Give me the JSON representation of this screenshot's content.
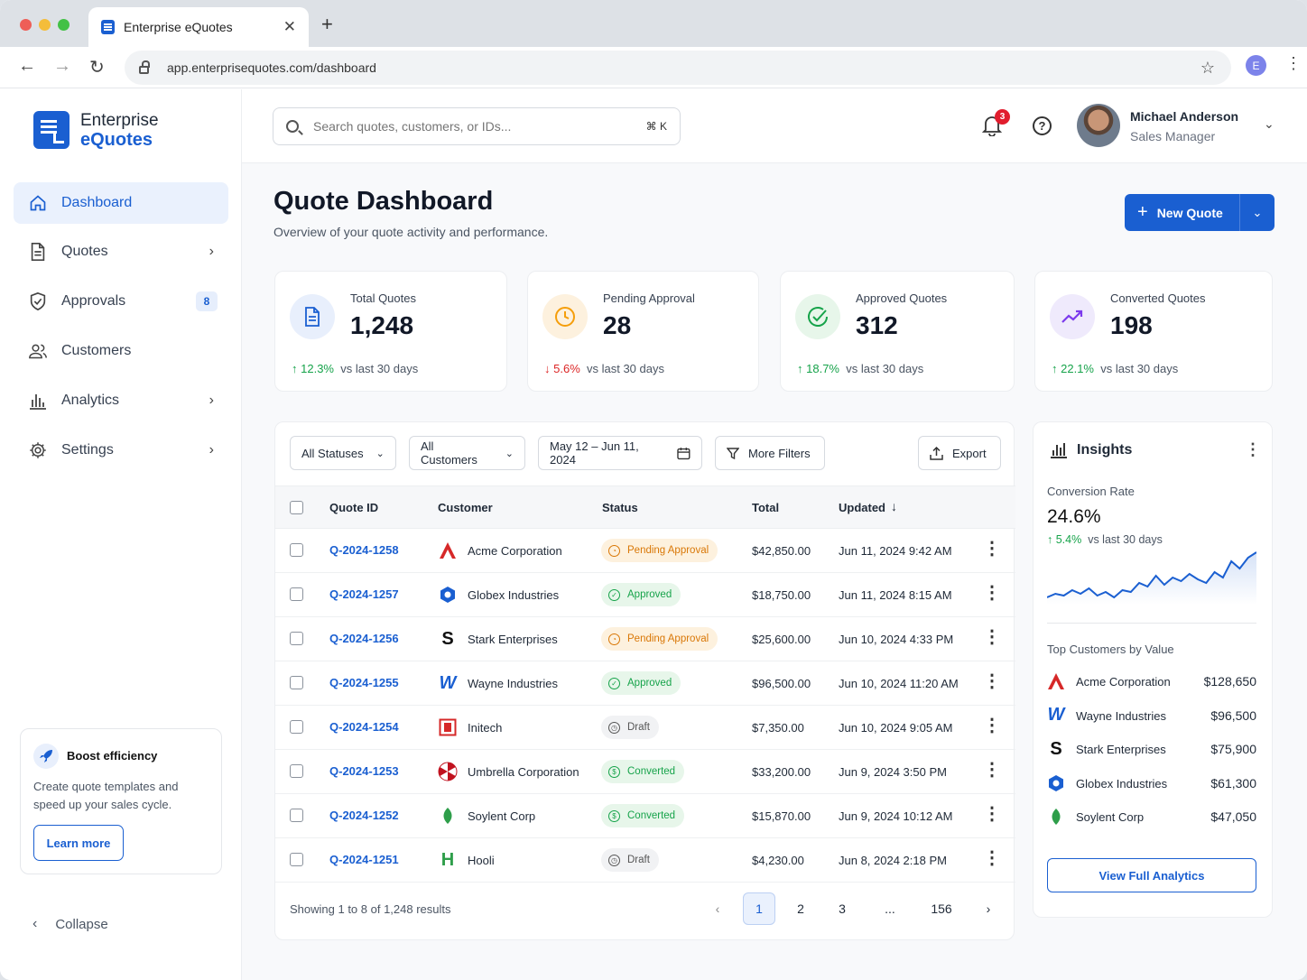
{
  "browser": {
    "tab_title": "Enterprise eQuotes",
    "url": "app.enterprisequotes.com/dashboard",
    "profile_initial": "E"
  },
  "sidebar": {
    "brand_line1": "Enterprise",
    "brand_line2": "eQuotes",
    "items": [
      {
        "label": "Dashboard",
        "icon": "home-icon"
      },
      {
        "label": "Quotes",
        "icon": "document-icon"
      },
      {
        "label": "Approvals",
        "icon": "shield-icon",
        "badge": "8"
      },
      {
        "label": "Customers",
        "icon": "users-icon"
      },
      {
        "label": "Analytics",
        "icon": "bar-chart-icon"
      },
      {
        "label": "Settings",
        "icon": "gear-icon"
      }
    ],
    "boost": {
      "title": "Boost efficiency",
      "desc": "Create quote templates and speed up your sales cycle.",
      "button": "Learn more"
    },
    "collapse": "Collapse"
  },
  "header": {
    "search_placeholder": "Search quotes, customers, or IDs...",
    "search_shortcut": "⌘ K",
    "notifications": "3",
    "user_name": "Michael Anderson",
    "user_role": "Sales Manager"
  },
  "page": {
    "title": "Quote Dashboard",
    "subtitle": "Overview of your quote activity and performance.",
    "new_quote": "New Quote"
  },
  "colors": {
    "brand": "#1a5fd1",
    "up": "#16a34a",
    "down": "#dc2626",
    "pending": "#d97706"
  },
  "stats": [
    {
      "label": "Total Quotes",
      "value": "1,248",
      "delta": "12.3%",
      "dir": "up",
      "suffix": "vs last 30 days",
      "icon": "document-icon"
    },
    {
      "label": "Pending Approval",
      "value": "28",
      "delta": "5.6%",
      "dir": "down",
      "suffix": "vs last 30 days",
      "icon": "clock-icon"
    },
    {
      "label": "Approved Quotes",
      "value": "312",
      "delta": "18.7%",
      "dir": "up",
      "suffix": "vs last 30 days",
      "icon": "check-circle-icon"
    },
    {
      "label": "Converted Quotes",
      "value": "198",
      "delta": "22.1%",
      "dir": "up",
      "suffix": "vs last 30 days",
      "icon": "trend-up-icon"
    }
  ],
  "filters": {
    "status": "All Statuses",
    "customers": "All Customers",
    "date_range": "May 12 – Jun 11, 2024",
    "more": "More Filters",
    "export": "Export"
  },
  "table": {
    "headers": [
      "Quote ID",
      "Customer",
      "Status",
      "Total",
      "Updated"
    ],
    "rows": [
      {
        "id": "Q-2024-1258",
        "customer": "Acme Corporation",
        "status": "Pending Approval",
        "status_kind": "pending",
        "total": "$42,850.00",
        "updated": "Jun 11, 2024 9:42 AM"
      },
      {
        "id": "Q-2024-1257",
        "customer": "Globex Industries",
        "status": "Approved",
        "status_kind": "approved",
        "total": "$18,750.00",
        "updated": "Jun 11, 2024 8:15 AM"
      },
      {
        "id": "Q-2024-1256",
        "customer": "Stark Enterprises",
        "status": "Pending Approval",
        "status_kind": "pending",
        "total": "$25,600.00",
        "updated": "Jun 10, 2024 4:33 PM"
      },
      {
        "id": "Q-2024-1255",
        "customer": "Wayne Industries",
        "status": "Approved",
        "status_kind": "approved",
        "total": "$96,500.00",
        "updated": "Jun 10, 2024 11:20 AM"
      },
      {
        "id": "Q-2024-1254",
        "customer": "Initech",
        "status": "Draft",
        "status_kind": "draft",
        "total": "$7,350.00",
        "updated": "Jun 10, 2024 9:05 AM"
      },
      {
        "id": "Q-2024-1253",
        "customer": "Umbrella Corporation",
        "status": "Converted",
        "status_kind": "converted",
        "total": "$33,200.00",
        "updated": "Jun 9, 2024 3:50 PM"
      },
      {
        "id": "Q-2024-1252",
        "customer": "Soylent Corp",
        "status": "Converted",
        "status_kind": "converted",
        "total": "$15,870.00",
        "updated": "Jun 9, 2024 10:12 AM"
      },
      {
        "id": "Q-2024-1251",
        "customer": "Hooli",
        "status": "Draft",
        "status_kind": "draft",
        "total": "$4,230.00",
        "updated": "Jun 8, 2024 2:18 PM"
      }
    ],
    "showing": "Showing 1 to 8 of 1,248 results",
    "pages": [
      "1",
      "2",
      "3",
      "...",
      "156"
    ]
  },
  "insights": {
    "title": "Insights",
    "conversion_label": "Conversion Rate",
    "conversion_value": "24.6%",
    "conversion_delta": "5.4%",
    "conversion_suffix": "vs last 30 days",
    "top_label": "Top Customers by Value",
    "top_customers": [
      {
        "name": "Acme Corporation",
        "value": "$128,650"
      },
      {
        "name": "Wayne Industries",
        "value": "$96,500"
      },
      {
        "name": "Stark Enterprises",
        "value": "$75,900"
      },
      {
        "name": "Globex Industries",
        "value": "$61,300"
      },
      {
        "name": "Soylent Corp",
        "value": "$47,050"
      }
    ],
    "button": "View Full Analytics"
  },
  "chart_data": {
    "type": "line",
    "series": [
      {
        "values": [
          18,
          20,
          19,
          22,
          20,
          23,
          19,
          21,
          18,
          22,
          21,
          26,
          24,
          30,
          25,
          29,
          27,
          31,
          28,
          26,
          32,
          29,
          38,
          34,
          40,
          43
        ]
      }
    ],
    "grid": false,
    "title": "",
    "xlabel": "",
    "ylabel": ""
  }
}
